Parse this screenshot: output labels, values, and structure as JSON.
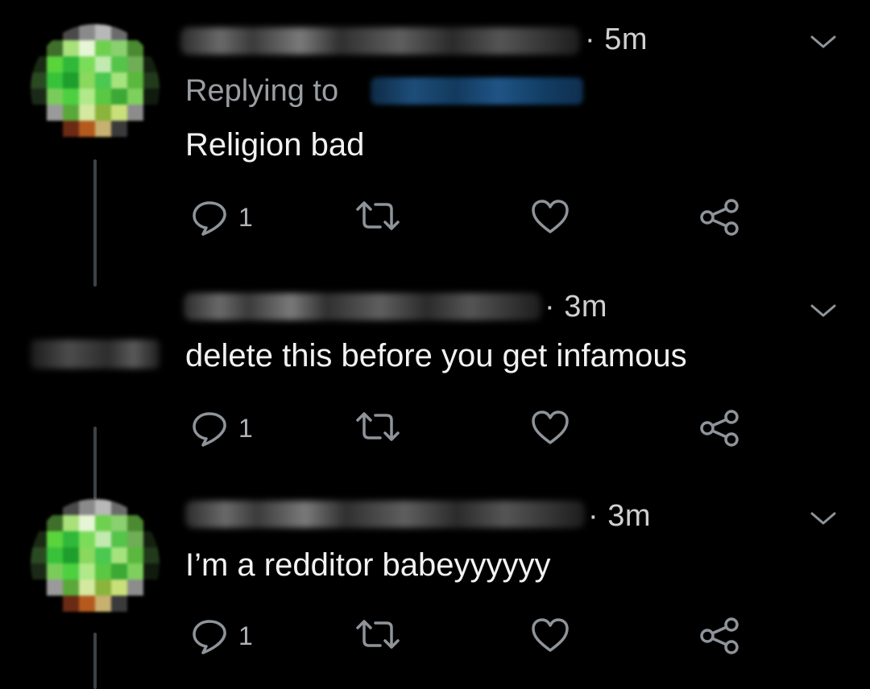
{
  "tweets": [
    {
      "time": "· 5m",
      "reply_label": "Replying to",
      "text": "Religion bad",
      "reply_count": "1"
    },
    {
      "time": "· 3m",
      "text": "delete this before you get infamous",
      "reply_count": "1"
    },
    {
      "time": "· 3m",
      "text": "I’m a redditor babeyyyyyy",
      "reply_count": "1"
    }
  ],
  "icons": {
    "reply": "reply-icon",
    "retweet": "retweet-icon",
    "like": "heart-icon",
    "share": "share-icon",
    "menu": "chevron-down-icon"
  },
  "colors": {
    "background": "#000000",
    "text": "#f2f2f2",
    "muted": "#9a9ea3",
    "icon": "#8e949a",
    "thread_line": "#3d4148"
  }
}
